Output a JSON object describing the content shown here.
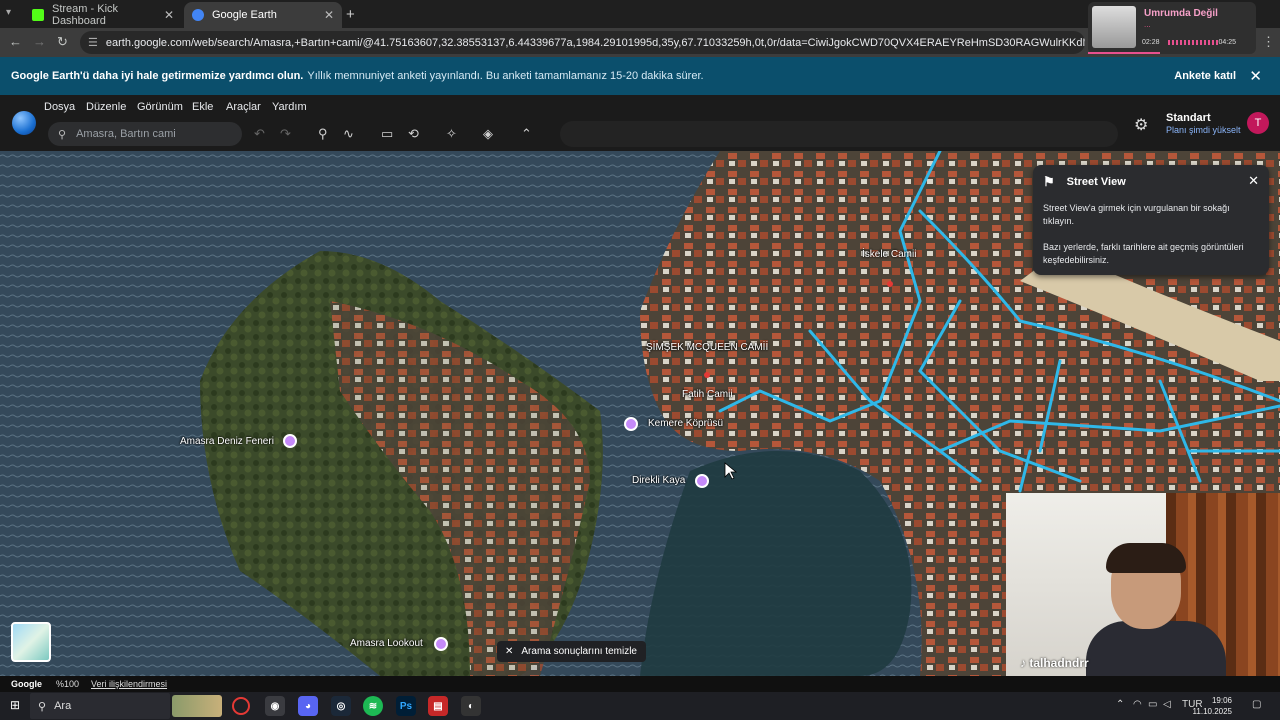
{
  "browser": {
    "tabs": [
      {
        "title": "Stream - Kick Dashboard",
        "favicon_color": "#53fc18"
      },
      {
        "title": "Google Earth",
        "favicon_color": "#4285f4"
      }
    ],
    "url": "earth.google.com/web/search/Amasra,+Bartın+cami/@41.75163607,32.38553137,6.44339677a,1984.29101995d,35y,67.71033259h,0t,0r/data=CiwiJgokCWD70QVX4ERAEYReHmSD30RAGWulrKKdMUBAIT...",
    "icons": {
      "back": "back-arrow-icon",
      "forward": "forward-arrow-icon",
      "reload": "reload-icon",
      "site": "site-settings-icon"
    }
  },
  "media_popup": {
    "title": "Umrumda Değil",
    "subtitle": "...",
    "time_current": "02:28",
    "time_total": "04:25"
  },
  "banner": {
    "bold": "Google Earth'ü daha iyi hale getirmemize yardımcı olun.",
    "text": "Yıllık memnuniyet anketi yayınlandı. Bu anketi tamamlamanız 15-20 dakika sürer.",
    "action": "Ankete katıl"
  },
  "earth": {
    "menu": [
      "Dosya",
      "Düzenle",
      "Görünüm",
      "Ekle",
      "Araçlar",
      "Yardım"
    ],
    "search_placeholder": "Amasra, Bartın cami",
    "plan_title": "Standart",
    "plan_link": "Planı şimdi yükselt",
    "avatar_letter": "T",
    "tools": [
      "undo-icon",
      "redo-icon",
      "placemark-icon",
      "path-icon",
      "ruler-icon",
      "history-icon",
      "tools-icon",
      "layers-icon",
      "collapse-icon"
    ]
  },
  "map": {
    "labels": [
      "İskele Camii",
      "ŞİMŞEK MCQUEEN CAMİİ",
      "Fatih Camii",
      "Kemere Köprüsü",
      "Direkli Kaya",
      "Amasra Deniz Feneri",
      "Amasra Lookout"
    ]
  },
  "street_view": {
    "title": "Street View",
    "p1": "Street View'a girmek için vurgulanan bir sokağı tıklayın.",
    "p2": "Bazı yerlerde, farklı tarihlere ait geçmiş görüntüleri keşfedebilirsiniz."
  },
  "clear_chip": "Arama sonuçlarını temizle",
  "webcam": {
    "handle": "talhadndrr"
  },
  "status": {
    "brand": "Google",
    "zoom": "%100",
    "data": "Veri ilişkilendirmesi"
  },
  "taskbar": {
    "search": "Ara",
    "language": "TUR",
    "time": "19:06",
    "date": "11.10.2025"
  },
  "colors": {
    "banner": "#0b4f6c",
    "streetview_lines": "#2fb8e8",
    "poi": "#c58af9"
  }
}
